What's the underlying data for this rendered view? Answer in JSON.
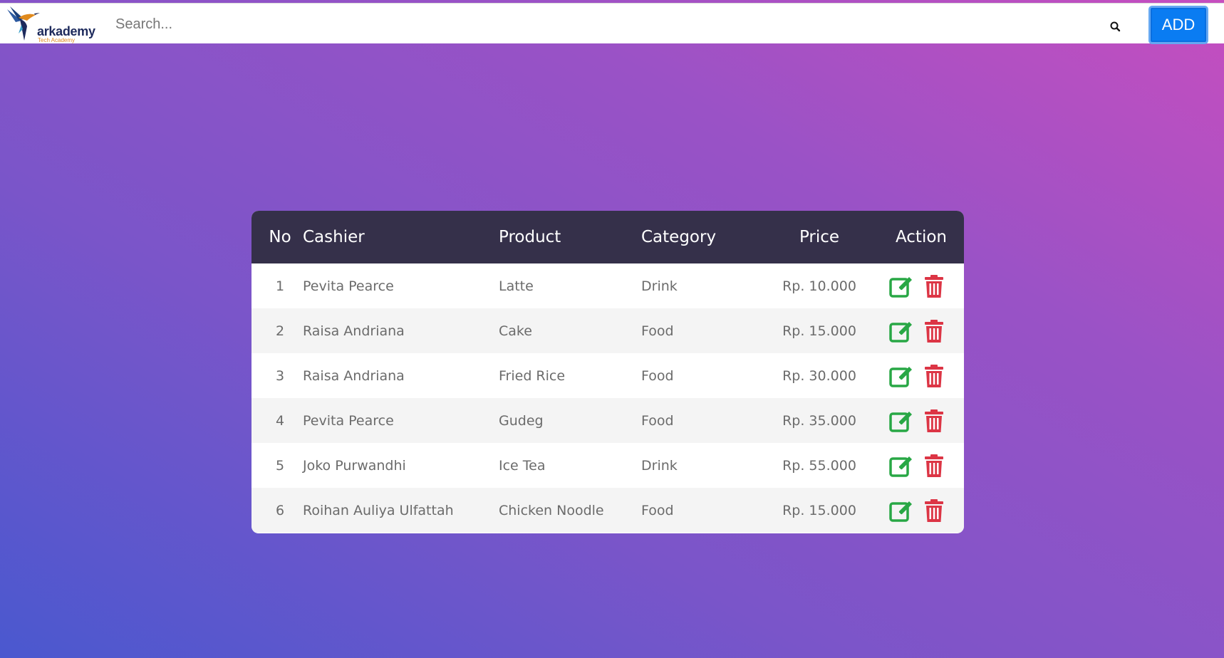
{
  "navbar": {
    "logo_text": "arkademy",
    "logo_subtext": "Tech Academy",
    "search_placeholder": "Search...",
    "search_icon": "search-icon",
    "add_label": "ADD",
    "add_color": "#0a7cf2"
  },
  "table": {
    "headers": {
      "no": "No",
      "cashier": "Cashier",
      "product": "Product",
      "category": "Category",
      "price": "Price",
      "action": "Action"
    },
    "rows": [
      {
        "no": "1",
        "cashier": "Pevita Pearce",
        "product": "Latte",
        "category": "Drink",
        "price": "Rp. 10.000"
      },
      {
        "no": "2",
        "cashier": "Raisa Andriana",
        "product": "Cake",
        "category": "Food",
        "price": "Rp. 15.000"
      },
      {
        "no": "3",
        "cashier": "Raisa Andriana",
        "product": "Fried Rice",
        "category": "Food",
        "price": "Rp. 30.000"
      },
      {
        "no": "4",
        "cashier": "Pevita Pearce",
        "product": "Gudeg",
        "category": "Food",
        "price": "Rp. 35.000"
      },
      {
        "no": "5",
        "cashier": "Joko Purwandhi",
        "product": "Ice Tea",
        "category": "Drink",
        "price": "Rp. 55.000"
      },
      {
        "no": "6",
        "cashier": "Roihan Auliya Ulfattah",
        "product": "Chicken Noodle",
        "category": "Food",
        "price": "Rp. 15.000"
      }
    ],
    "action_icons": {
      "edit": "edit-icon",
      "delete": "trash-icon"
    },
    "colors": {
      "header_bg": "#35304a",
      "edit": "#28a745",
      "delete": "#dc3545"
    }
  }
}
